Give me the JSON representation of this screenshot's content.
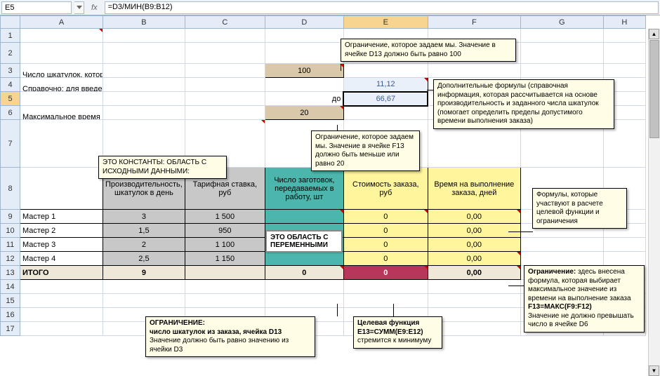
{
  "formula_bar": {
    "cell_ref": "E5",
    "fx_label": "fx",
    "formula": "=D3/МИН(B9:B12)"
  },
  "columns": [
    "A",
    "B",
    "C",
    "D",
    "E",
    "F",
    "G",
    "H"
  ],
  "row3": {
    "label": "Число шкатулок, которые требуется произвести, шт:",
    "val": "100"
  },
  "row4": {
    "label": "Справочно: для введенного числа шкатулок время выполнения заказа возможно от",
    "val": "11,12"
  },
  "row5": {
    "label": "до",
    "val": "66,67"
  },
  "row6": {
    "label": "Максимальное время выполнения заказа, дней:",
    "val": "20"
  },
  "row8": {
    "b": "Производительность, шкатулок в день",
    "c": "Тарифная ставка, руб",
    "d": "Число заготовок, передаваемых в работу, шт",
    "e": "Стоимость заказа, руб",
    "f": "Время на выполнение заказа, дней"
  },
  "data_rows": [
    {
      "a": "Мастер 1",
      "b": "3",
      "c": "1 500",
      "e": "0",
      "f": "0,00"
    },
    {
      "a": "Мастер 2",
      "b": "1,5",
      "c": "950",
      "e": "0",
      "f": "0,00"
    },
    {
      "a": "Мастер 3",
      "b": "2",
      "c": "1 100",
      "e": "0",
      "f": "0,00"
    },
    {
      "a": "Мастер 4",
      "b": "2,5",
      "c": "1 150",
      "e": "0",
      "f": "0,00"
    }
  ],
  "row13": {
    "a": "ИТОГО",
    "b": "9",
    "d": "0",
    "e": "0",
    "f": "0,00"
  },
  "comments": {
    "c1": "Ограничение, которое задаем мы. Значение в ячейке D13 должно быть равно 100",
    "c2": "Дополнительные формулы (справочная информация, которая рассчитывается на основе производительность и заданного числа шкатулок (помогает определить пределы допустимого времени выполнения заказа)",
    "c3": "Ограничение, которое задаем мы. Значение в ячейке F13 должно быть меньше или равно 20",
    "c4": "ЭТО КОНСТАНТЫ: ОБЛАСТЬ С ИСХОДНЫМИ ДАННЫМИ:",
    "c5": "Формулы, которые участвуют в расчете целевой функции и ограничения",
    "c6": {
      "l1": "ОГРАНИЧЕНИЕ:",
      "l2": "число шкатулок из заказа, ячейка D13",
      "l3": "Значение должно быть равно значению из ячейки D3"
    },
    "c7": {
      "l1": "Целевая функция",
      "l2": "E13=СУММ(E9:E12)",
      "l3": "стремится к минимуму"
    },
    "c8": {
      "l1a": "Ограничение: ",
      "l1b": "здесь внесена формула, которая выбирает максимальное значение из времени на выполнение заказа",
      "l2": "F13=МАКС(F9:F12)",
      "l3": "Значение не должно превышать число в ячейке D6"
    }
  },
  "overlays": {
    "o1": "ЭТО ОБЛАСТЬ С ПЕРЕМЕННЫМИ"
  }
}
